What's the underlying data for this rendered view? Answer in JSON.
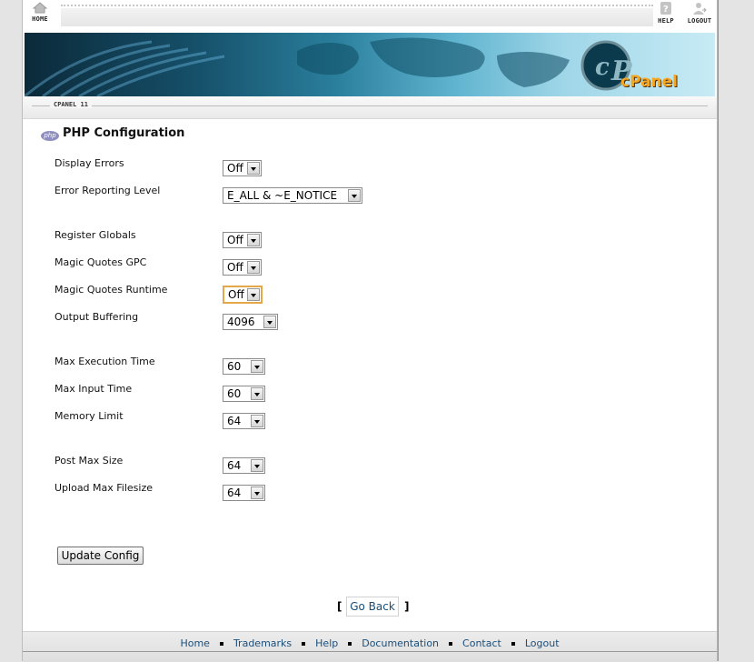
{
  "topnav": {
    "home": "HOME",
    "help": "HELP",
    "logout": "LOGOUT"
  },
  "banner": {
    "brand": "cPanel"
  },
  "version_label": "CPANEL 11",
  "page": {
    "icon_text": "php",
    "title": "PHP Configuration"
  },
  "fields": [
    {
      "label": "Display Errors",
      "value": "Off"
    },
    {
      "label": "Error Reporting Level",
      "value": "E_ALL & ~E_NOTICE"
    },
    {
      "label": "Register Globals",
      "value": "Off"
    },
    {
      "label": "Magic Quotes GPC",
      "value": "Off"
    },
    {
      "label": "Magic Quotes Runtime",
      "value": "Off"
    },
    {
      "label": "Output Buffering",
      "value": "4096"
    },
    {
      "label": "Max Execution Time",
      "value": "60"
    },
    {
      "label": "Max Input Time",
      "value": "60"
    },
    {
      "label": "Memory Limit",
      "value": "64"
    },
    {
      "label": "Post Max Size",
      "value": "64"
    },
    {
      "label": "Upload Max Filesize",
      "value": "64"
    }
  ],
  "update_button": "Update Config",
  "go_back": {
    "open": "[",
    "label": "Go Back",
    "close": "]"
  },
  "footer": {
    "links": [
      "Home",
      "Trademarks",
      "Help",
      "Documentation",
      "Contact",
      "Logout"
    ]
  }
}
